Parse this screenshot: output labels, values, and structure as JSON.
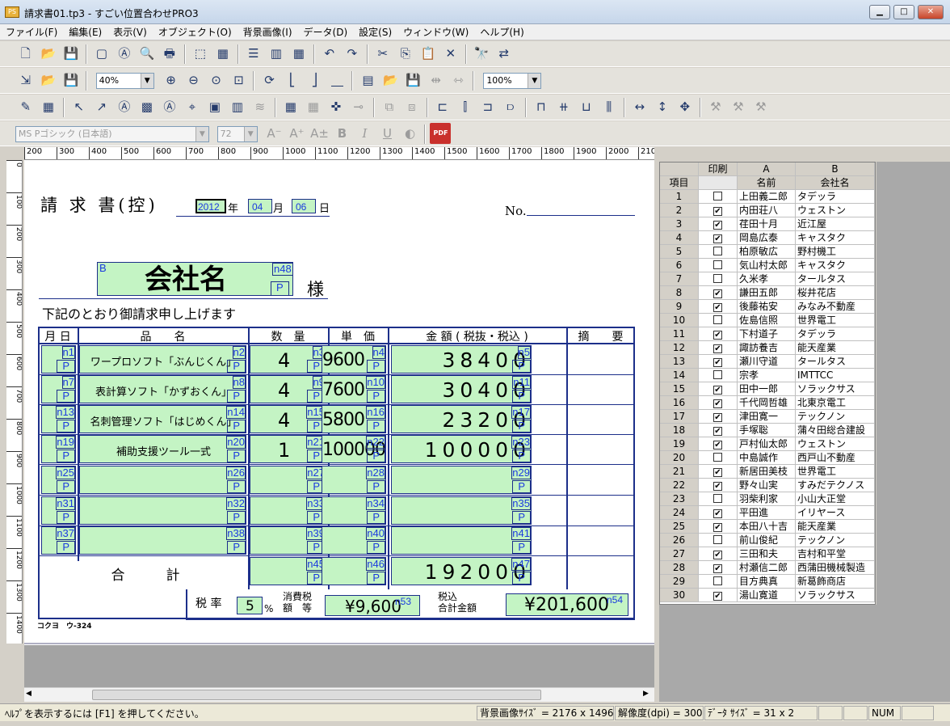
{
  "window": {
    "title": "請求書01.tp3 - すごい位置合わせPRO3",
    "min_label": "▁",
    "max_label": "□",
    "close_label": "✕"
  },
  "menu": [
    "ファイル(F)",
    "編集(E)",
    "表示(V)",
    "オブジェクト(O)",
    "背景画像(I)",
    "データ(D)",
    "設定(S)",
    "ウィンドウ(W)",
    "ヘルプ(H)"
  ],
  "toolbar": {
    "zoom_value": "40%",
    "zoom2_value": "100%",
    "font_name": "MS Pゴシック (日本語)",
    "font_size": "72",
    "bold": "B",
    "italic": "I",
    "underline": "U",
    "pdf": "PDF"
  },
  "ruler": {
    "h_ticks": [
      "200",
      "300",
      "400",
      "500",
      "600",
      "700",
      "800",
      "900",
      "1000",
      "1100",
      "1200",
      "1300",
      "1400",
      "1500",
      "1600",
      "1700",
      "1800",
      "1900",
      "2000",
      "210"
    ],
    "v_ticks": [
      "0",
      "100",
      "200",
      "300",
      "400",
      "500",
      "600",
      "700",
      "800",
      "900",
      "1000",
      "1100",
      "1200",
      "1300",
      "1400"
    ]
  },
  "invoice": {
    "title": "請 求 書(控)",
    "year_value": "2012",
    "year_suffix": "年",
    "month_value": "04",
    "month_suffix": "月",
    "day_value": "06",
    "day_suffix": "日",
    "no_label": "No.",
    "company_name": "会社名",
    "company_field_b": "B",
    "company_field_n": "n48",
    "company_field_p": "P",
    "sama": "様",
    "intro": "下記のとおり御請求申し上げます",
    "headers": [
      "月 日",
      "品　　名",
      "数　量",
      "単　価",
      "金 額 ( 税抜・税込 )",
      "摘　　要"
    ],
    "rows": [
      {
        "nl": "n1",
        "item": "ワープロソフト「ぶんじくん」",
        "ni": "n2",
        "qty": "4",
        "nq": "n3",
        "price": "9600",
        "np": "n4",
        "amount": "38400",
        "na": "n5"
      },
      {
        "nl": "n7",
        "item": "表計算ソフト「かずおくん」",
        "ni": "n8",
        "qty": "4",
        "nq": "n9",
        "price": "7600",
        "np": "n10",
        "amount": "30400",
        "na": "n11"
      },
      {
        "nl": "n13",
        "item": "名刺管理ソフト「はじめくん」",
        "ni": "n14",
        "qty": "4",
        "nq": "n15",
        "price": "5800",
        "np": "n16",
        "amount": "23200",
        "na": "n17"
      },
      {
        "nl": "n19",
        "item": "補助支援ツール一式",
        "ni": "n20",
        "qty": "1",
        "nq": "n21",
        "price": "100000",
        "np": "n22",
        "amount": "100000",
        "na": "n23"
      },
      {
        "nl": "n25",
        "item": "",
        "ni": "n26",
        "qty": "",
        "nq": "n27",
        "price": "",
        "np": "n28",
        "amount": "",
        "na": "n29"
      },
      {
        "nl": "n31",
        "item": "",
        "ni": "n32",
        "qty": "",
        "nq": "n33",
        "price": "",
        "np": "n34",
        "amount": "",
        "na": "n35"
      },
      {
        "nl": "n37",
        "item": "",
        "ni": "n38",
        "qty": "",
        "nq": "n39",
        "price": "",
        "np": "n40",
        "amount": "",
        "na": "n41"
      }
    ],
    "p_label": "P",
    "total_label": "合　　　計",
    "total_value": "192000",
    "total_n_qty": "n45",
    "total_n_price": "n46",
    "total_n_amount": "n47",
    "tax_rate_label": "税 率",
    "tax_rate_value": "5",
    "percent": "%",
    "tax_amount_label1": "消費税",
    "tax_amount_label2": "額　等",
    "tax_amount_value": "¥9,600",
    "tax_amount_n": "n53",
    "taxin_label1": "税込",
    "taxin_label2": "合計金額",
    "taxin_value": "¥201,600",
    "taxin_n": "n54",
    "footer": "コクヨ　ウ-324"
  },
  "grid": {
    "col_headers": [
      "",
      "印刷",
      "A",
      "B"
    ],
    "sub_headers": [
      "項目",
      "",
      "名前",
      "会社名"
    ],
    "rows": [
      {
        "no": "1",
        "print": false,
        "name": "上田義二郎",
        "company": "タデッラ"
      },
      {
        "no": "2",
        "print": true,
        "name": "内田荘八",
        "company": "ウェストン"
      },
      {
        "no": "3",
        "print": true,
        "name": "荏田十月",
        "company": "近江屋"
      },
      {
        "no": "4",
        "print": true,
        "name": "岡島広泰",
        "company": "キャスタク"
      },
      {
        "no": "5",
        "print": false,
        "name": "柏原敏広",
        "company": "野村機工"
      },
      {
        "no": "6",
        "print": false,
        "name": "気山村太郎",
        "company": "キャスタク"
      },
      {
        "no": "7",
        "print": false,
        "name": "久米孝",
        "company": "タールタス"
      },
      {
        "no": "8",
        "print": true,
        "name": "謙田五郎",
        "company": "桜井花店"
      },
      {
        "no": "9",
        "print": true,
        "name": "後藤祐安",
        "company": "みなみ不動産"
      },
      {
        "no": "10",
        "print": false,
        "name": "佐島信照",
        "company": "世界電工"
      },
      {
        "no": "11",
        "print": true,
        "name": "下村道子",
        "company": "タデッラ"
      },
      {
        "no": "12",
        "print": true,
        "name": "諏訪養吉",
        "company": "能天産業"
      },
      {
        "no": "13",
        "print": true,
        "name": "瀬川守道",
        "company": "タールタス"
      },
      {
        "no": "14",
        "print": false,
        "name": "宗孝",
        "company": "IMTTCC"
      },
      {
        "no": "15",
        "print": true,
        "name": "田中一郎",
        "company": "ソラックサス"
      },
      {
        "no": "16",
        "print": true,
        "name": "千代岡哲雄",
        "company": "北東京電工"
      },
      {
        "no": "17",
        "print": true,
        "name": "津田寛一",
        "company": "テックノン"
      },
      {
        "no": "18",
        "print": true,
        "name": "手塚聡",
        "company": "蒲々田総合建設"
      },
      {
        "no": "19",
        "print": true,
        "name": "戸村仙太郎",
        "company": "ウェストン"
      },
      {
        "no": "20",
        "print": false,
        "name": "中島誠作",
        "company": "西戸山不動産"
      },
      {
        "no": "21",
        "print": true,
        "name": "新居田美枝",
        "company": "世界電工"
      },
      {
        "no": "22",
        "print": true,
        "name": "野々山実",
        "company": "すみだテクノス"
      },
      {
        "no": "23",
        "print": false,
        "name": "羽柴利家",
        "company": "小山大正堂"
      },
      {
        "no": "24",
        "print": true,
        "name": "平田進",
        "company": "イリヤース"
      },
      {
        "no": "25",
        "print": true,
        "name": "本田八十吉",
        "company": "能天産業"
      },
      {
        "no": "26",
        "print": false,
        "name": "前山俊紀",
        "company": "テックノン"
      },
      {
        "no": "27",
        "print": true,
        "name": "三田和夫",
        "company": "吉村和平堂"
      },
      {
        "no": "28",
        "print": true,
        "name": "村瀬信二郎",
        "company": "西蒲田機械製造"
      },
      {
        "no": "29",
        "print": false,
        "name": "目方典真",
        "company": "新葛飾商店"
      },
      {
        "no": "30",
        "print": true,
        "name": "湯山寛道",
        "company": "ソラックサス"
      }
    ],
    "check_mark": "✔"
  },
  "status": {
    "help": "ﾍﾙﾌﾟを表示するには [F1] を押してください。",
    "image_size": "背景画像ｻｲｽﾞ = 2176 x 1496",
    "dpi": "解像度(dpi) = 300",
    "data_size": "ﾃﾞｰﾀ ｻｲｽﾞ = 31 x 2",
    "num": "NUM"
  }
}
